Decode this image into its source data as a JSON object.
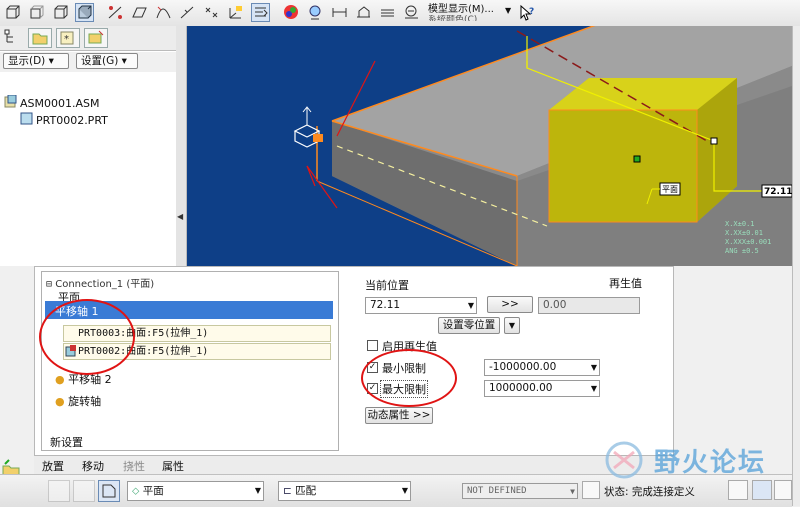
{
  "toolbar": {
    "view_display_label": "模型显示(M)...",
    "system_colors_label": "系统颜色(C)"
  },
  "left_panel": {
    "display_menu": "显示(D) ▾",
    "settings_menu": "设置(G) ▾",
    "tree": [
      {
        "label": "ASM0001.ASM"
      },
      {
        "label": "PRT0002.PRT"
      }
    ]
  },
  "viewport": {
    "dimension_value": "72.11",
    "plane_tag": "平面",
    "precision_lines": [
      "X.X±0.1",
      "X.XX±0.01",
      "X.XXX±0.001",
      "ANG ±0.5"
    ]
  },
  "dashboard": {
    "connection_title": "Connection_1 (平面)",
    "constraint_label": "平面",
    "translation_axis_1": "平移轴 1",
    "ref_1": "PRT0003:曲面:F5(拉伸_1)",
    "ref_2": "PRT0002:曲面:F5(拉伸_1)",
    "translation_axis_2": "平移轴 2",
    "rotation_axis": "旋转轴",
    "new_setting": "新设置",
    "current_position_label": "当前位置",
    "current_position_value": "72.11",
    "jump_button": ">>",
    "regen_label": "再生值",
    "regen_value": "0.00",
    "set_zero_button": "设置零位置",
    "enable_regen_label": "启用再生值",
    "min_limit_label": "最小限制",
    "min_limit_value": "-1000000.00",
    "max_limit_label": "最大限制",
    "max_limit_value": "1000000.00",
    "dynamic_props_button": "动态属性 >>"
  },
  "bottom_tabs": [
    "放置",
    "移动",
    "挠性",
    "属性"
  ],
  "bottom_bar": {
    "constraint_type": "平面",
    "match_type": "匹配",
    "not_defined": "NOT DEFINED",
    "status": "状态: 完成连接定义"
  },
  "watermark": "野火论坛"
}
